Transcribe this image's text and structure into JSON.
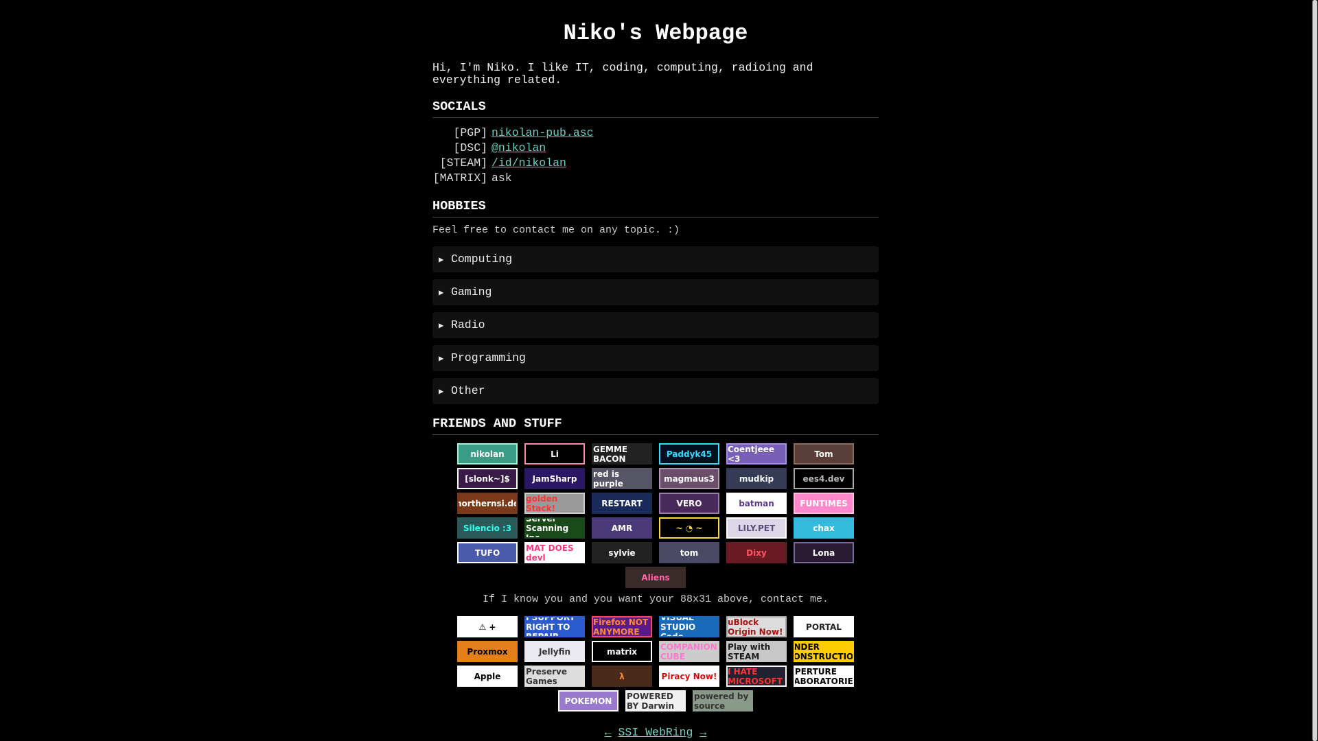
{
  "title": "Niko's Webpage",
  "intro": "Hi, I'm Niko. I like IT, coding, computing, radioing and everything related.",
  "socials": {
    "heading": "SOCIALS",
    "rows": [
      {
        "tag": "[PGP]",
        "value": "nikolan-pub.asc",
        "link": true
      },
      {
        "tag": "[DSC]",
        "value": "@nikolan",
        "link": true
      },
      {
        "tag": "[STEAM]",
        "value": "/id/nikolan",
        "link": true
      },
      {
        "tag": "[MATRIX]",
        "value": "ask",
        "link": false
      }
    ]
  },
  "hobbies": {
    "heading": "HOBBIES",
    "note": "Feel free to contact me on any topic. :)",
    "items": [
      "Computing",
      "Gaming",
      "Radio",
      "Programming",
      "Other"
    ]
  },
  "friends": {
    "heading": "FRIENDS AND STUFF",
    "buttons": [
      {
        "label": "nikolan",
        "bg": "#3a9c84",
        "fg": "#ffffff",
        "border": "#9ff0d8"
      },
      {
        "label": "Li",
        "bg": "#000000",
        "fg": "#ffffff",
        "border": "#ff88aa"
      },
      {
        "label": "GEMME BACON",
        "bg": "#222222",
        "fg": "#ffffff",
        "border": "#222222"
      },
      {
        "label": "Paddyk45",
        "bg": "#001020",
        "fg": "#33ddff",
        "border": "#33ddff"
      },
      {
        "label": "Coentjeee <3",
        "bg": "#7a5fb8",
        "fg": "#ffffff",
        "border": "#a98bea"
      },
      {
        "label": "Tom",
        "bg": "#5a3f38",
        "fg": "#ffffff",
        "border": "#8b6b5e"
      },
      {
        "label": "[slonk~]$",
        "bg": "#3a1a48",
        "fg": "#ffffff",
        "border": "#ffffff"
      },
      {
        "label": "JamSharp",
        "bg": "#2a1866",
        "fg": "#ffffff",
        "border": "#2a1866"
      },
      {
        "label": "red is purple",
        "bg": "#555566",
        "fg": "#ffffff",
        "border": "#555566"
      },
      {
        "label": "magmaus3",
        "bg": "#6a4e6a",
        "fg": "#ffffff",
        "border": "#b49ab4"
      },
      {
        "label": "mudkip",
        "bg": "#353a55",
        "fg": "#ffffff",
        "border": "#353a55"
      },
      {
        "label": "ees4.dev",
        "bg": "#000000",
        "fg": "#bbbbbb",
        "border": "#aaaaaa"
      },
      {
        "label": "northernsi.de",
        "bg": "#7a3a1a",
        "fg": "#ffffff",
        "border": "#7a3a1a"
      },
      {
        "label": "golden Stack!",
        "bg": "#9a9a9a",
        "fg": "#ff3333",
        "border": "#cccccc"
      },
      {
        "label": "RESTART",
        "bg": "#1a2a5a",
        "fg": "#ffffff",
        "border": "#1a2a5a"
      },
      {
        "label": "VERO",
        "bg": "#4a2a5a",
        "fg": "#ffffff",
        "border": "#9b7bb0"
      },
      {
        "label": "batman",
        "bg": "#ffffff",
        "fg": "#5a3a8a",
        "border": "#ffffff"
      },
      {
        "label": "FUNTIMES",
        "bg": "#ff88cc",
        "fg": "#ffffff",
        "border": "#ffbbdd"
      },
      {
        "label": "Silencio :3",
        "bg": "#2a5a5a",
        "fg": "#33ffee",
        "border": "#2a5a5a"
      },
      {
        "label": "Server Scanning Inc",
        "bg": "#1a4a1a",
        "fg": "#ffffff",
        "border": "#1a4a1a"
      },
      {
        "label": "AMR",
        "bg": "#4a3a7a",
        "fg": "#ffffff",
        "border": "#4a3a7a"
      },
      {
        "label": "~ ◔ ~",
        "bg": "#000000",
        "fg": "#ffdd33",
        "border": "#ffdd33"
      },
      {
        "label": "LILY.PET",
        "bg": "#dcd6e6",
        "fg": "#5a4a7a",
        "border": "#ffffff"
      },
      {
        "label": "chax",
        "bg": "#33bbdd",
        "fg": "#ffffff",
        "border": "#33bbdd"
      },
      {
        "label": "TUFO",
        "bg": "#4a5aaa",
        "fg": "#ffffff",
        "border": "#ffffff"
      },
      {
        "label": "MAT DOES devl",
        "bg": "#ffffff",
        "fg": "#ff3377",
        "border": "#ffffff"
      },
      {
        "label": "sylvie",
        "bg": "#222222",
        "fg": "#ffffff",
        "border": "#222222"
      },
      {
        "label": "tom",
        "bg": "#4a4a66",
        "fg": "#ffffff",
        "border": "#4a4a66"
      },
      {
        "label": "Dixy",
        "bg": "#6a1a22",
        "fg": "#ff5566",
        "border": "#6a1a22"
      },
      {
        "label": "Lona",
        "bg": "#2a1a33",
        "fg": "#ffffff",
        "border": "#7a6a99"
      },
      {
        "label": "Aliens",
        "bg": "#3a2a2a",
        "fg": "#ff66aa",
        "border": "#3a2a2a"
      }
    ]
  },
  "caption": "If I know you and you want your 88x31 above, contact me.",
  "badges": [
    {
      "label": "⚠ +",
      "bg": "#ffffff",
      "fg": "#000000",
      "border": "#ffffff"
    },
    {
      "label": "I SUPPORT RIGHT TO REPAIR",
      "bg": "#2a5acc",
      "fg": "#ffffff",
      "border": "#2a5acc"
    },
    {
      "label": "Firefox NOT ANYMORE",
      "bg": "#5a1a8a",
      "fg": "#ff8833",
      "border": "#ff4466"
    },
    {
      "label": "VISUAL STUDIO Code",
      "bg": "#1a6abb",
      "fg": "#ffffff",
      "border": "#1a6abb"
    },
    {
      "label": "uBlock Origin Now!",
      "bg": "#dddddd",
      "fg": "#aa1111",
      "border": "#aaaaaa"
    },
    {
      "label": "PORTAL",
      "bg": "#ffffff",
      "fg": "#222222",
      "border": "#ffffff"
    },
    {
      "label": "Proxmox",
      "bg": "#e57f1a",
      "fg": "#000000",
      "border": "#e57f1a"
    },
    {
      "label": "Jellyfin",
      "bg": "#eaeaf0",
      "fg": "#333333",
      "border": "#eaeaf0"
    },
    {
      "label": "matrix",
      "bg": "#000000",
      "fg": "#ffffff",
      "border": "#ffffff"
    },
    {
      "label": "COMPANION CUBE",
      "bg": "#cccccc",
      "fg": "#ff77cc",
      "border": "#cccccc"
    },
    {
      "label": "Play with STEAM",
      "bg": "#c8c8c8",
      "fg": "#1a1a1a",
      "border": "#c8c8c8"
    },
    {
      "label": "UNDER CONSTRUCTION",
      "bg": "#ffcc00",
      "fg": "#000000",
      "border": "#ffcc00"
    },
    {
      "label": "Apple",
      "bg": "#ffffff",
      "fg": "#000000",
      "border": "#ffffff"
    },
    {
      "label": "Preserve Games",
      "bg": "#dddddd",
      "fg": "#333333",
      "border": "#dddddd"
    },
    {
      "label": "λ",
      "bg": "#4a2a1a",
      "fg": "#ff8833",
      "border": "#4a2a1a"
    },
    {
      "label": "Piracy Now!",
      "bg": "#ffffff",
      "fg": "#cc1111",
      "border": "#ffffff"
    },
    {
      "label": "I HATE MICROSOFT",
      "bg": "#222233",
      "fg": "#ff3333",
      "border": "#ffffff"
    },
    {
      "label": "APERTURE LABORATORIES",
      "bg": "#ffffff",
      "fg": "#000000",
      "border": "#ffffff"
    },
    {
      "label": "POKEMON",
      "bg": "#9a7acc",
      "fg": "#ffffff",
      "border": "#ffffff"
    },
    {
      "label": "POWERED BY Darwin",
      "bg": "#f0f0f0",
      "fg": "#333333",
      "border": "#f0f0f0"
    },
    {
      "label": "powered by source",
      "bg": "#8a9a8a",
      "fg": "#333333",
      "border": "#8a9a8a"
    }
  ],
  "webring": {
    "prev": "←",
    "label": "SSI WebRing",
    "next": "→"
  }
}
